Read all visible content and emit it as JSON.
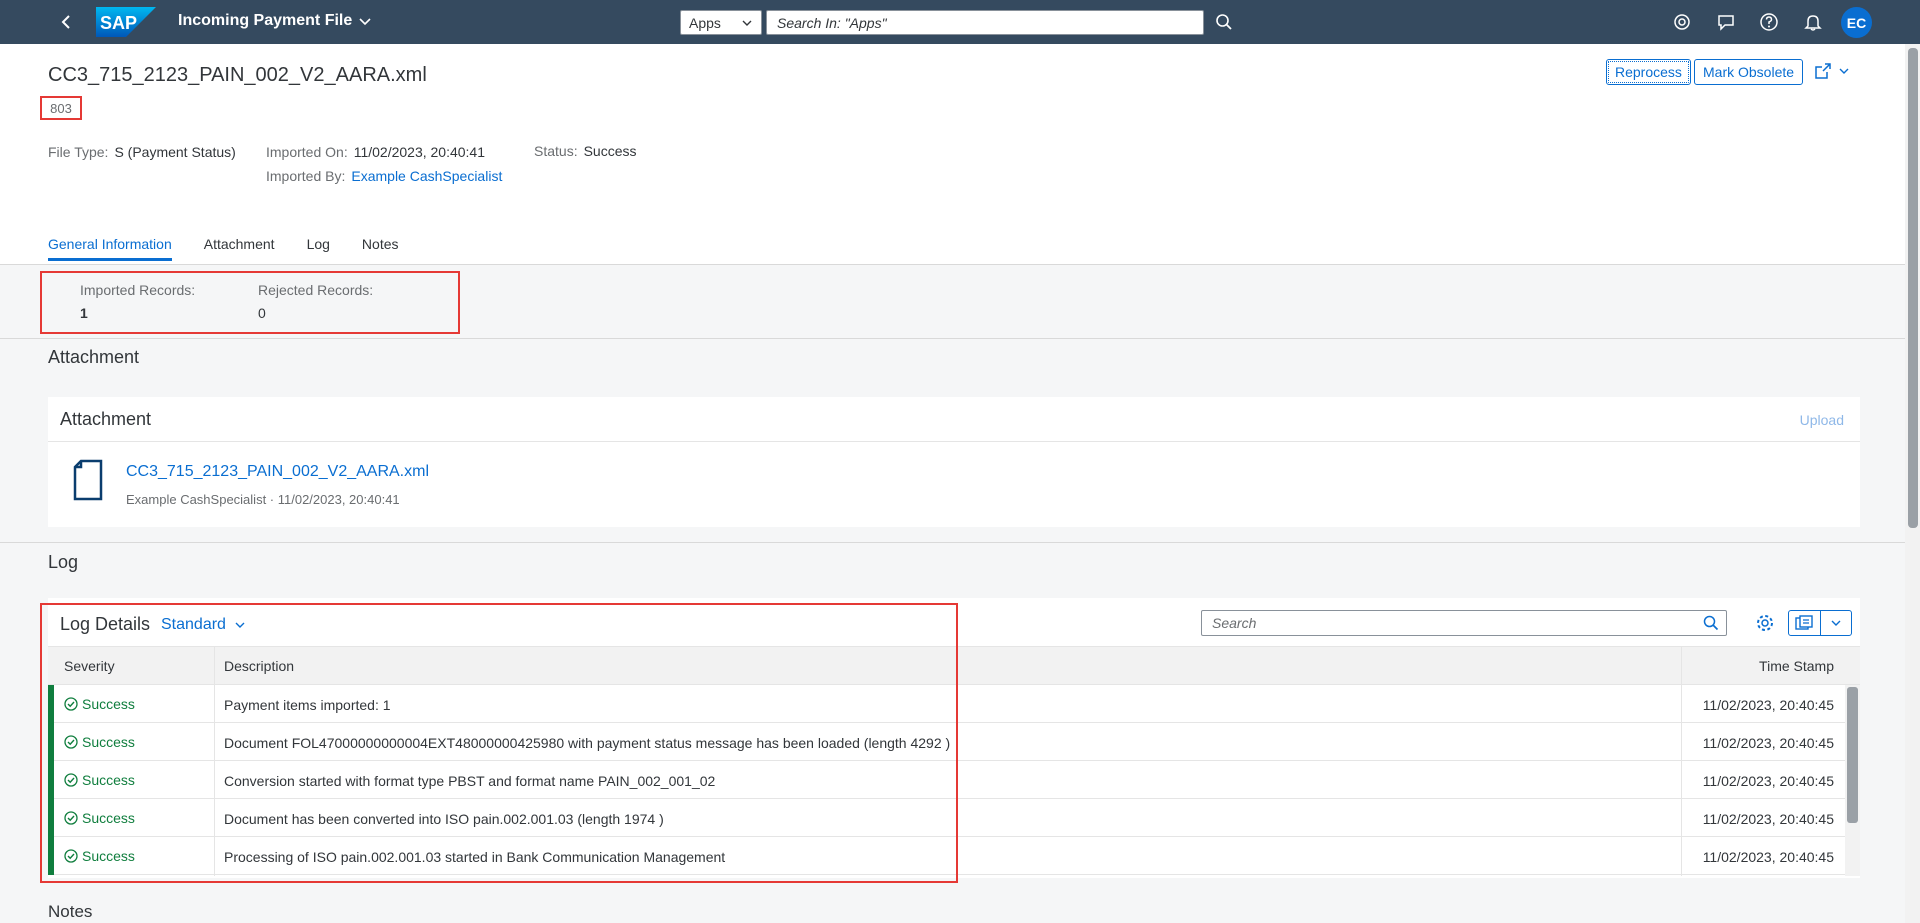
{
  "shell": {
    "app_title": "Incoming Payment File",
    "apps_select": "Apps",
    "search_placeholder": "Search In: \"Apps\"",
    "avatar_initials": "EC",
    "logo_text": "SAP"
  },
  "header": {
    "title": "CC3_715_2123_PAIN_002_V2_AARA.xml",
    "subtitle": "803",
    "buttons": {
      "reprocess": "Reprocess",
      "mark_obsolete": "Mark Obsolete"
    },
    "attributes": {
      "file_type_label": "File Type:",
      "file_type_value": "S (Payment Status)",
      "imported_on_label": "Imported On:",
      "imported_on_value": "11/02/2023, 20:40:41",
      "imported_by_label": "Imported By:",
      "imported_by_value": "Example CashSpecialist",
      "status_label": "Status:",
      "status_value": "Success"
    },
    "tabs": [
      "General Information",
      "Attachment",
      "Log",
      "Notes"
    ]
  },
  "general": {
    "imported_records_label": "Imported Records:",
    "imported_records_value": "1",
    "rejected_records_label": "Rejected Records:",
    "rejected_records_value": "0"
  },
  "attachment_section": {
    "section_title": "Attachment",
    "panel_title": "Attachment",
    "upload_label": "Upload",
    "file_name": "CC3_715_2123_PAIN_002_V2_AARA.xml",
    "file_meta": "Example CashSpecialist · 11/02/2023, 20:40:41"
  },
  "log_section": {
    "section_title": "Log",
    "panel_title": "Log Details",
    "variant": "Standard",
    "search_placeholder": "Search",
    "columns": {
      "severity": "Severity",
      "description": "Description",
      "timestamp": "Time Stamp"
    },
    "rows": [
      {
        "severity": "Success",
        "description": "Payment items imported: 1",
        "timestamp": "11/02/2023, 20:40:45"
      },
      {
        "severity": "Success",
        "description": "Document FOL47000000000004EXT48000000425980 with payment status message has been loaded (length 4292 )",
        "timestamp": "11/02/2023, 20:40:45"
      },
      {
        "severity": "Success",
        "description": "Conversion started with format type PBST and format name PAIN_002_001_02",
        "timestamp": "11/02/2023, 20:40:45"
      },
      {
        "severity": "Success",
        "description": "Document has been converted into ISO pain.002.001.03 (length 1974 )",
        "timestamp": "11/02/2023, 20:40:45"
      },
      {
        "severity": "Success",
        "description": "Processing of ISO pain.002.001.03 started in Bank Communication Management",
        "timestamp": "11/02/2023, 20:40:45"
      }
    ]
  },
  "notes_section": {
    "section_title": "Notes"
  },
  "colors": {
    "shell": "#354a5f",
    "accent": "#0a6ed1",
    "success": "#107e3e",
    "highlight": "#e53935"
  }
}
